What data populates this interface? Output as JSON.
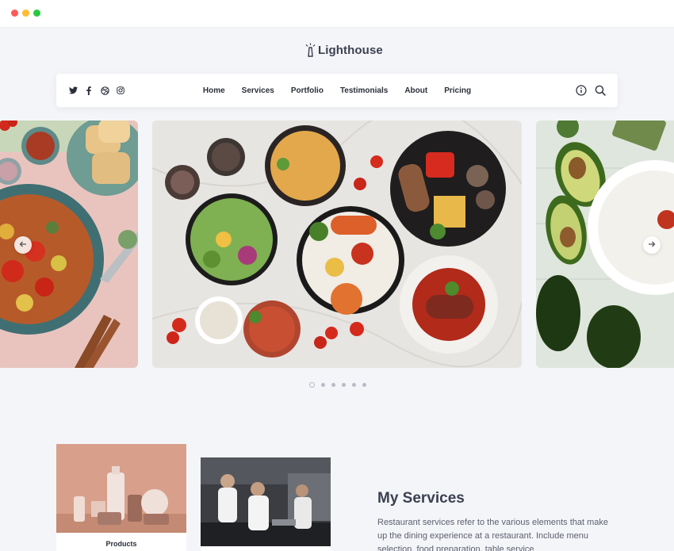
{
  "window": {
    "controls": [
      "close",
      "minimize",
      "maximize"
    ]
  },
  "brand": {
    "name": "Lighthouse",
    "icon": "lighthouse-icon"
  },
  "social": {
    "icons": [
      "twitter-icon",
      "facebook-icon",
      "dribbble-icon",
      "instagram-icon"
    ]
  },
  "nav": {
    "items": [
      {
        "label": "Home"
      },
      {
        "label": "Services"
      },
      {
        "label": "Portfolio"
      },
      {
        "label": "Testimonials"
      },
      {
        "label": "About"
      },
      {
        "label": "Pricing"
      }
    ],
    "actions": [
      "info-icon",
      "search-icon"
    ]
  },
  "carousel": {
    "slides": [
      "vegetable-stew-plate",
      "mediterranean-food-spread",
      "avocado-board"
    ],
    "active_index": 0,
    "dot_count": 6,
    "prev_icon": "arrow-left-icon",
    "next_icon": "arrow-right-icon"
  },
  "cards": [
    {
      "label": "Products"
    },
    {
      "label": ""
    }
  ],
  "services": {
    "title": "My Services",
    "body": "Restaurant services refer to the various elements that make up the dining experience at a restaurant. Include menu selection, food preparation, table service"
  },
  "colors": {
    "accent": "#3a4050",
    "background": "#f4f5f8"
  }
}
